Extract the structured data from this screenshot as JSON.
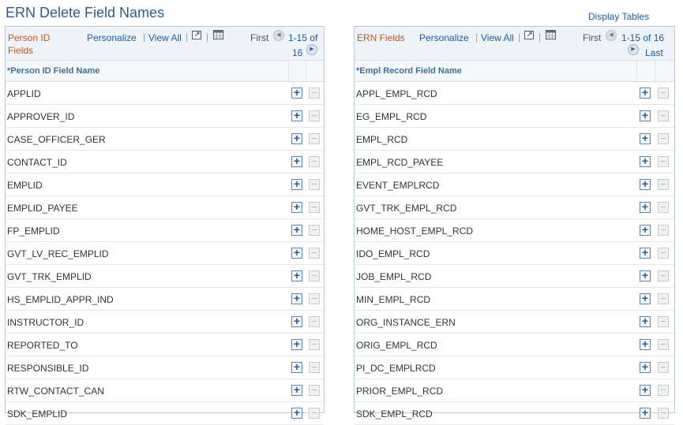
{
  "page": {
    "title": "ERN Delete Field Names",
    "display_tables": "Display Tables"
  },
  "left_grid": {
    "title": "Person ID Fields",
    "personalize": "Personalize",
    "view_all": "View All",
    "separator": "|",
    "first": "First",
    "range_line1": "1-15 of",
    "range_line2": "16",
    "column_header": "*Person ID Field Name",
    "rows": [
      "APPLID",
      "APPROVER_ID",
      "CASE_OFFICER_GER",
      "CONTACT_ID",
      "EMPLID",
      "EMPLID_PAYEE",
      "FP_EMPLID",
      "GVT_LV_REC_EMPLID",
      "GVT_TRK_EMPLID",
      "HS_EMPLID_APPR_IND",
      "INSTRUCTOR_ID",
      "REPORTED_TO",
      "RESPONSIBLE_ID",
      "RTW_CONTACT_CAN",
      "SDK_EMPLID"
    ]
  },
  "right_grid": {
    "title": "ERN Fields",
    "personalize": "Personalize",
    "view_all": "View All",
    "separator": "|",
    "first": "First",
    "range": "1-15 of 16",
    "last": "Last",
    "column_header": "*Empl Record Field Name",
    "rows": [
      "APPL_EMPL_RCD",
      "EG_EMPL_RCD",
      "EMPL_RCD",
      "EMPL_RCD_PAYEE",
      "EVENT_EMPLRCD",
      "GVT_TRK_EMPL_RCD",
      "HOME_HOST_EMPL_RCD",
      "IDO_EMPL_RCD",
      "JOB_EMPL_RCD",
      "MIN_EMPL_RCD",
      "ORG_INSTANCE_ERN",
      "ORIG_EMPL_RCD",
      "PI_DC_EMPLRCD",
      "PRIOR_EMPL_RCD",
      "SDK_EMPL_RCD"
    ]
  },
  "icons": {
    "zoom": "zoom-icon",
    "download": "download-grid-icon",
    "add_row": "+",
    "delete_row": "−",
    "prev": "◀",
    "next": "▶"
  },
  "colors": {
    "link": "#1a5ca8",
    "grid_title": "#c2571a",
    "page_title": "#2e5c8a",
    "header_bg": "#eef3f8",
    "border": "#b9c9d7"
  }
}
